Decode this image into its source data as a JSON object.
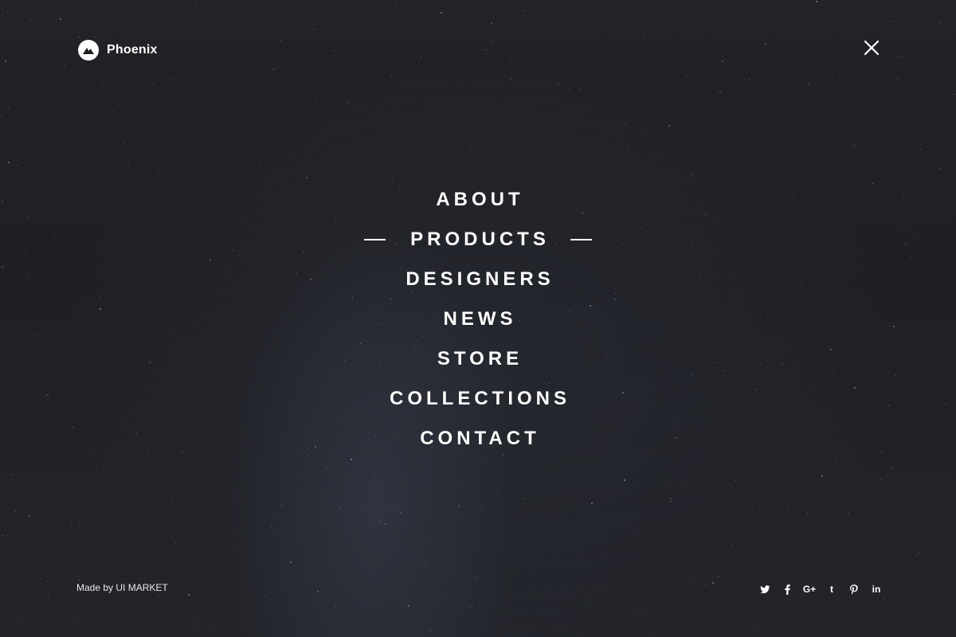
{
  "brand": {
    "name": "Phoenix",
    "logo_icon": "mountain-logo-icon"
  },
  "close_icon": "close-icon",
  "menu": {
    "items": [
      {
        "label": "ABOUT",
        "active": false
      },
      {
        "label": "PRODUCTS",
        "active": true
      },
      {
        "label": "DESIGNERS",
        "active": false
      },
      {
        "label": "NEWS",
        "active": false
      },
      {
        "label": "STORE",
        "active": false
      },
      {
        "label": "COLLECTIONS",
        "active": false
      },
      {
        "label": "CONTACT",
        "active": false
      }
    ]
  },
  "footer": {
    "credit": "Made by UI MARKET",
    "social": [
      {
        "name": "twitter-icon"
      },
      {
        "name": "facebook-icon"
      },
      {
        "name": "google-plus-icon",
        "glyph": "G+"
      },
      {
        "name": "tumblr-icon",
        "glyph": "t"
      },
      {
        "name": "pinterest-icon"
      },
      {
        "name": "linkedin-icon",
        "glyph": "in"
      }
    ]
  },
  "colors": {
    "background": "#1e1f22",
    "text": "#ffffff"
  }
}
